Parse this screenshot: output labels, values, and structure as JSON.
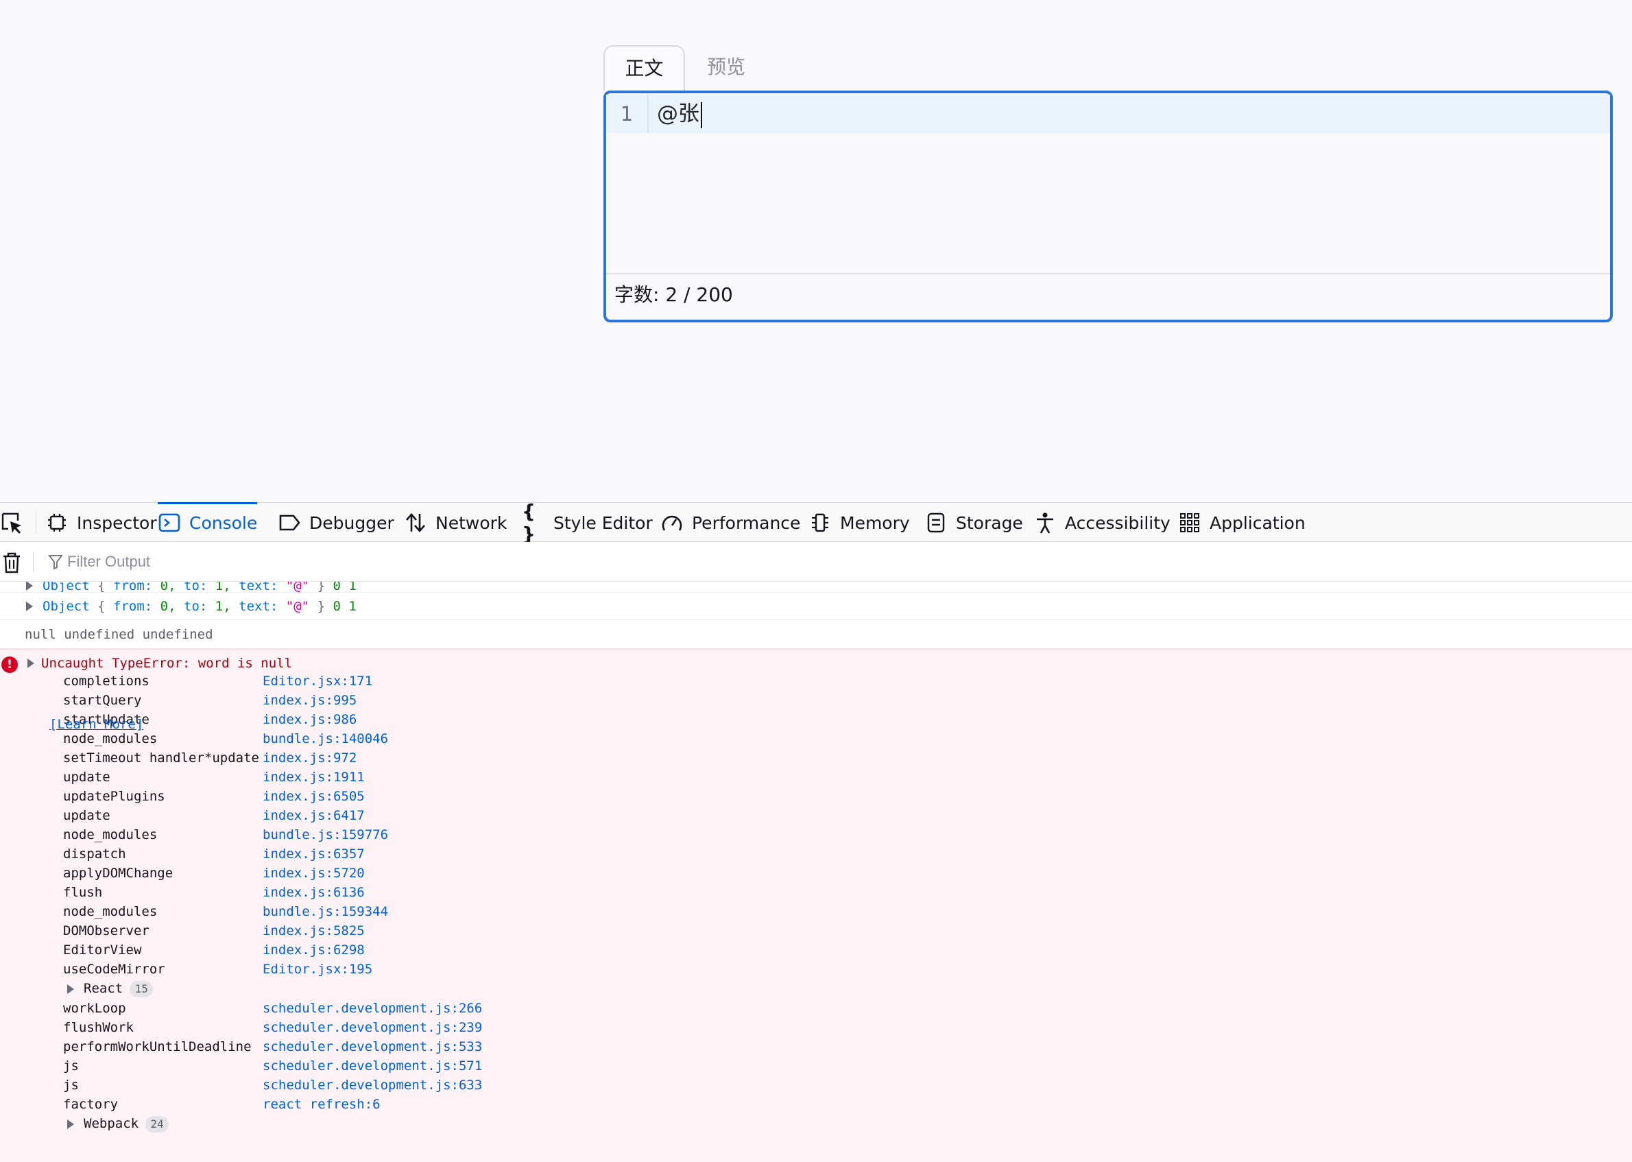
{
  "editor": {
    "tabs": [
      {
        "label": "正文"
      },
      {
        "label": "预览"
      }
    ],
    "line_number": "1",
    "content": "@张",
    "footer_label": "字数: 2 / 200"
  },
  "devtools": {
    "tabs": [
      {
        "label": "Inspector",
        "icon": "inspector-icon"
      },
      {
        "label": "Console",
        "icon": "console-icon"
      },
      {
        "label": "Debugger",
        "icon": "debugger-icon"
      },
      {
        "label": "Network",
        "icon": "network-icon"
      },
      {
        "label": "Style Editor",
        "icon": "style-editor-icon"
      },
      {
        "label": "Performance",
        "icon": "performance-icon"
      },
      {
        "label": "Memory",
        "icon": "memory-icon"
      },
      {
        "label": "Storage",
        "icon": "storage-icon"
      },
      {
        "label": "Accessibility",
        "icon": "accessibility-icon"
      },
      {
        "label": "Application",
        "icon": "application-icon"
      }
    ],
    "selected_tab": "Console",
    "filter_placeholder": "Filter Output",
    "console": {
      "object_row": {
        "type": "Object",
        "open": "{",
        "from_key": "from:",
        "from_val": "0,",
        "to_key": "to:",
        "to_val": "1,",
        "text_key": "text:",
        "text_val": "\"@\"",
        "close": "}",
        "extra": "0 1"
      },
      "null_row": "null undefined undefined",
      "error": {
        "message": "Uncaught TypeError: word is null",
        "frames": [
          {
            "fn": "completions",
            "file": "Editor.jsx",
            "line": ":171"
          },
          {
            "fn": "startQuery",
            "file": "index.js",
            "line": ":995"
          },
          {
            "fn": "startUpdate",
            "file": "index.js",
            "line": ":986"
          },
          {
            "fn": "node_modules",
            "file": "bundle.js",
            "line": ":140046"
          },
          {
            "fn": "setTimeout handler*update",
            "file": "index.js",
            "line": ":972"
          },
          {
            "fn": "update",
            "file": "index.js",
            "line": ":1911"
          },
          {
            "fn": "updatePlugins",
            "file": "index.js",
            "line": ":6505"
          },
          {
            "fn": "update",
            "file": "index.js",
            "line": ":6417"
          },
          {
            "fn": "node_modules",
            "file": "bundle.js",
            "line": ":159776"
          },
          {
            "fn": "dispatch",
            "file": "index.js",
            "line": ":6357"
          },
          {
            "fn": "applyDOMChange",
            "file": "index.js",
            "line": ":5720"
          },
          {
            "fn": "flush",
            "file": "index.js",
            "line": ":6136"
          },
          {
            "fn": "node_modules",
            "file": "bundle.js",
            "line": ":159344"
          },
          {
            "fn": "DOMObserver",
            "file": "index.js",
            "line": ":5825"
          },
          {
            "fn": "EditorView",
            "file": "index.js",
            "line": ":6298"
          },
          {
            "fn": "useCodeMirror",
            "file": "Editor.jsx",
            "line": ":195"
          }
        ],
        "group1": {
          "label": "React",
          "count": "15"
        },
        "frames2": [
          {
            "fn": "workLoop",
            "file": "scheduler.development.js",
            "line": ":266"
          },
          {
            "fn": "flushWork",
            "file": "scheduler.development.js",
            "line": ":239"
          },
          {
            "fn": "performWorkUntilDeadline",
            "file": "scheduler.development.js",
            "line": ":533"
          },
          {
            "fn": "js",
            "file": "scheduler.development.js",
            "line": ":571"
          },
          {
            "fn": "js",
            "file": "scheduler.development.js",
            "line": ":633"
          },
          {
            "fn": "factory",
            "file": "react refresh",
            "line": ":6"
          }
        ],
        "group2": {
          "label": "Webpack",
          "count": "24"
        },
        "learn_more": "[Learn More]"
      }
    }
  },
  "colors": {
    "accent": "#2a74e0",
    "devtools_selected": "#0060df",
    "error_bg": "#fdf2f5",
    "error_text": "#a4000f"
  }
}
